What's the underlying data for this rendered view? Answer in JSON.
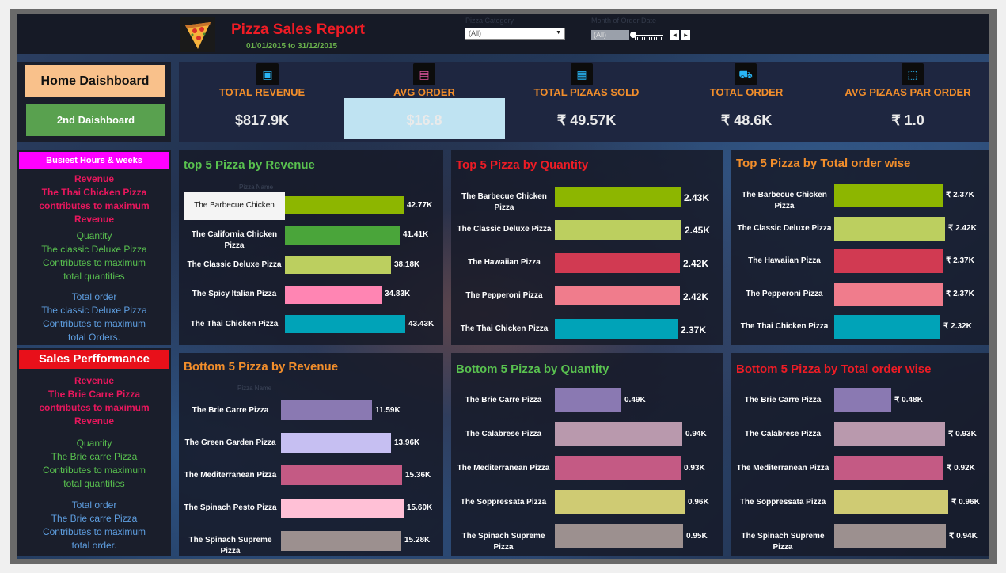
{
  "header": {
    "title": "Pizza Sales Report",
    "date_range": "01/01/2015 to 31/12/2015",
    "filter_label": "Pizza Category",
    "category_value": "(All)",
    "slider_label": "Month of Order Date",
    "slider_value": "(All)",
    "prev": "◂",
    "next": "▸"
  },
  "nav": {
    "home": "Home Daishboard",
    "second": "2nd Daishboard"
  },
  "kpis": [
    {
      "label": "TOTAL REVENUE",
      "value": "$817.9K",
      "icon": "money-icon"
    },
    {
      "label": "AVG ORDER",
      "value": "$16.8",
      "icon": "card-icon"
    },
    {
      "label": "TOTAL PIZAAS SOLD",
      "value": "₹ 49.57K",
      "icon": "receipt-icon"
    },
    {
      "label": "TOTAL ORDER",
      "value": "₹ 48.6K",
      "icon": "delivery-icon"
    },
    {
      "label": "AVG PIZAAS PAR ORDER",
      "value": "₹ 1.0",
      "icon": "box-icon"
    }
  ],
  "busiest": {
    "title": "Busiest Hours & weeks",
    "revenue": [
      "Revenue",
      "The Thai Chicken Pizza",
      "contributes to maximum",
      "Revenue"
    ],
    "quantity": [
      "Quantity",
      "The classic Deluxe Pizza",
      "Contributes to maximum",
      "total quantities"
    ],
    "order": [
      "Total order",
      "The classic Deluxe Pizza",
      "Contributes to maximum",
      "total Orders."
    ]
  },
  "sales": {
    "title": "Sales Perfformance",
    "revenue": [
      "Revenue",
      "The Brie Carre Pizza",
      "contributes to maximum",
      "Revenue"
    ],
    "quantity": [
      "Quantity",
      "The Brie carre Pizza",
      "Contributes to maximum",
      "total quantities"
    ],
    "order": [
      "Total order",
      "The Brie carre Pizza",
      "Contributes to maximum",
      "total order."
    ]
  },
  "chart_data": [
    {
      "type": "bar",
      "title": "top 5 Pizza by Revenue",
      "ylabel": "Pizza Name",
      "categories": [
        "The Barbecue Chicken Pizza",
        "The California Chicken Pizza",
        "The Classic Deluxe Pizza",
        "The Spicy Italian Pizza",
        "The Thai Chicken Pizza"
      ],
      "values": [
        42.77,
        41.41,
        38.18,
        34.83,
        43.43
      ],
      "labels": [
        "42.77K",
        "41.41K",
        "38.18K",
        "34.83K",
        "43.43K"
      ],
      "colors": [
        "#8db600",
        "#4aa53a",
        "#bccf5f",
        "#ff85b3",
        "#00a3b8"
      ]
    },
    {
      "type": "bar",
      "title": "Top 5 Pizza by Quantity",
      "categories": [
        "The Barbecue Chicken Pizza",
        "The Classic Deluxe Pizza",
        "The Hawaiian Pizza",
        "The Pepperoni Pizza",
        "The Thai Chicken Pizza"
      ],
      "values": [
        2.43,
        2.45,
        2.42,
        2.42,
        2.37
      ],
      "labels": [
        "2.43K",
        "2.45K",
        "2.42K",
        "2.42K",
        "2.37K"
      ],
      "colors": [
        "#8db600",
        "#bccf5f",
        "#d13a52",
        "#f07c8c",
        "#00a3b8"
      ]
    },
    {
      "type": "bar",
      "title": "Top 5 Pizza by Total order wise",
      "categories": [
        "The Barbecue Chicken Pizza",
        "The Classic Deluxe Pizza",
        "The Hawaiian Pizza",
        "The Pepperoni Pizza",
        "The Thai Chicken Pizza"
      ],
      "values": [
        2.37,
        2.42,
        2.37,
        2.37,
        2.32
      ],
      "labels": [
        "₹ 2.37K",
        "₹ 2.42K",
        "₹ 2.37K",
        "₹ 2.37K",
        "₹ 2.32K"
      ],
      "colors": [
        "#8db600",
        "#bccf5f",
        "#d13a52",
        "#f07c8c",
        "#00a3b8"
      ]
    },
    {
      "type": "bar",
      "title": "Bottom 5 Pizza by Revenue",
      "ylabel": "Pizza Name",
      "categories": [
        "The Brie Carre Pizza",
        "The Green Garden Pizza",
        "The Mediterranean Pizza",
        "The Spinach Pesto Pizza",
        "The Spinach Supreme Pizza"
      ],
      "values": [
        11.59,
        13.96,
        15.36,
        15.6,
        15.28
      ],
      "labels": [
        "11.59K",
        "13.96K",
        "15.36K",
        "15.60K",
        "15.28K"
      ],
      "colors": [
        "#8a79b2",
        "#c6bff2",
        "#c45a84",
        "#ffc0d6",
        "#9c908f"
      ]
    },
    {
      "type": "bar",
      "title": "Bottom 5 Pizza by Quantity",
      "categories": [
        "The Brie Carre Pizza",
        "The Calabrese Pizza",
        "The Mediterranean Pizza",
        "The Soppressata Pizza",
        "The Spinach Supreme Pizza"
      ],
      "values": [
        0.49,
        0.94,
        0.93,
        0.96,
        0.95
      ],
      "labels": [
        "0.49K",
        "0.94K",
        "0.93K",
        "0.96K",
        "0.95K"
      ],
      "colors": [
        "#8a79b2",
        "#b999ad",
        "#c45a84",
        "#cfcb73",
        "#9c908f"
      ]
    },
    {
      "type": "bar",
      "title": "Bottom 5 Pizza by Total order wise",
      "categories": [
        "The Brie Carre Pizza",
        "The Calabrese Pizza",
        "The Mediterranean Pizza",
        "The Soppressata Pizza",
        "The Spinach Supreme Pizza"
      ],
      "values": [
        0.48,
        0.93,
        0.92,
        0.96,
        0.94
      ],
      "labels": [
        "₹ 0.48K",
        "₹ 0.93K",
        "₹ 0.92K",
        "₹ 0.96K",
        "₹ 0.94K"
      ],
      "colors": [
        "#8a79b2",
        "#b999ad",
        "#c45a84",
        "#cfcb73",
        "#9c908f"
      ]
    }
  ]
}
